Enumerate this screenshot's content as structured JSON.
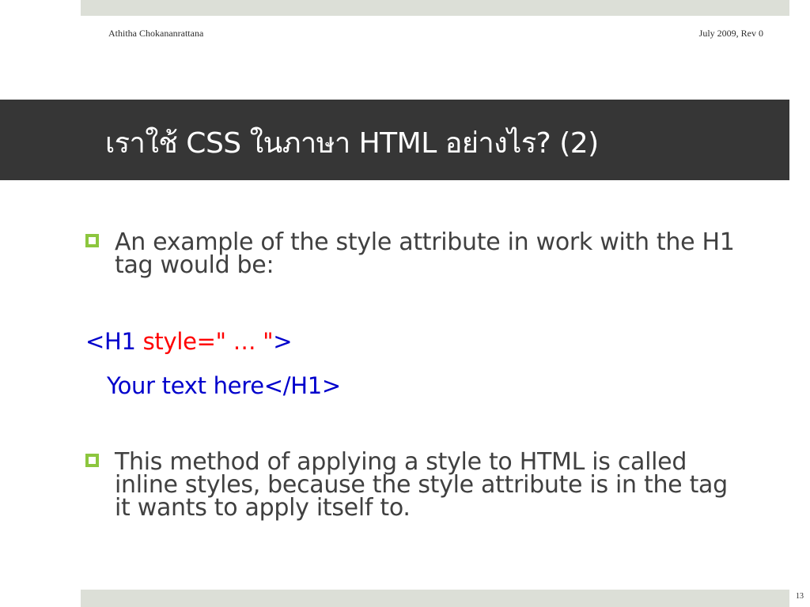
{
  "header": {
    "author": "Athitha Chokananrattana",
    "date_rev": "July 2009, Rev 0"
  },
  "title": "เราใช้ CSS ในภาษา HTML อย่างไร? (2)",
  "bullets": [
    {
      "text": "An example of the style attribute in work with the H1 tag would be:"
    },
    {
      "text": "This method of applying a style to HTML is called inline styles, because the style attribute is in the tag it wants to apply itself to."
    }
  ],
  "code": {
    "line1_open": "<H1 ",
    "line1_attr": "style=\" … \"",
    "line1_close": ">",
    "line2": "Your text here</H1>"
  },
  "colors": {
    "title_bar": "#363636",
    "bullet_accent": "#8cc63e",
    "band": "#dcdfd7",
    "code_blue": "#0000cc",
    "code_red": "#ff0000"
  },
  "footer": {
    "page_number": "13"
  }
}
